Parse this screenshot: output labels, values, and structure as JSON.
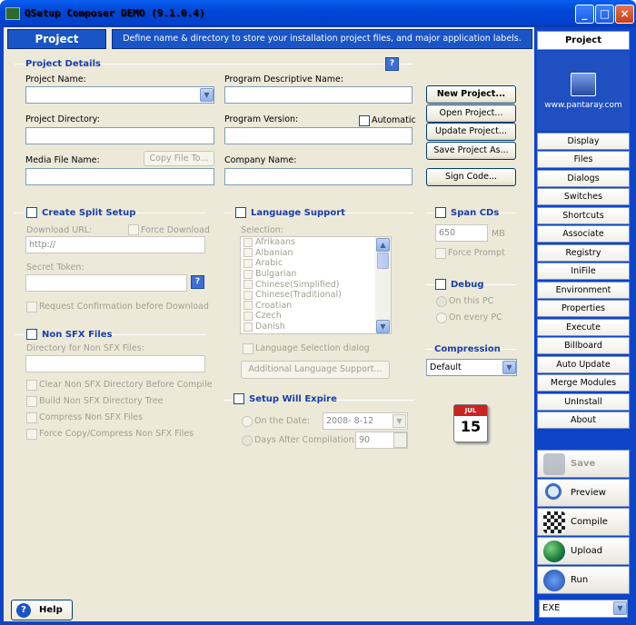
{
  "window": {
    "title": "QSetup Composer DEMO (9.1.0.4)",
    "minimize": "_",
    "maximize": "□",
    "close": "×"
  },
  "header": {
    "section": "Project",
    "description": "Define name & directory to store your installation project files, and major application labels."
  },
  "details": {
    "legend": "Project Details",
    "help": "?",
    "project_name": "Project Name:",
    "descriptive_name": "Program Descriptive Name:",
    "directory": "Project Directory:",
    "version": "Program Version:",
    "automatic": "Automatic",
    "media_file": "Media File Name:",
    "copy_file": "Copy File To...",
    "company": "Company Name:"
  },
  "project_buttons": {
    "new": "New Project...",
    "open": "Open Project...",
    "update": "Update Project...",
    "save_as": "Save Project As...",
    "sign": "Sign Code..."
  },
  "split": {
    "title": "Create Split Setup",
    "download_url": "Download URL:",
    "force_download": "Force Download",
    "url_value": "http://",
    "secret_token": "Secret Token:",
    "help": "?",
    "request_confirm": "Request Confirmation before Download"
  },
  "nonsfx": {
    "title": "Non SFX Files",
    "dir": "Directory for Non SFX Files:",
    "options": [
      "Clear Non SFX Directory Before Compile",
      "Build Non SFX Directory Tree",
      "Compress Non SFX Files",
      "Force Copy/Compress Non SFX Files"
    ]
  },
  "language": {
    "title": "Language Support",
    "selection": "Selection:",
    "items": [
      "Afrikaans",
      "Albanian",
      "Arabic",
      "Bulgarian",
      "Chinese(Simplified)",
      "Chinese(Traditional)",
      "Croatian",
      "Czech",
      "Danish"
    ],
    "dialog": "Language Selection dialog",
    "additional": "Additional Language Support..."
  },
  "expire": {
    "title": "Setup Will Expire",
    "on_date": "On the Date:",
    "date_value": "2008- 8-12",
    "after_compile": "Days After Compilation:",
    "days_value": "90"
  },
  "spancds": {
    "title": "Span CDs",
    "size": "650",
    "unit": "MB",
    "force_prompt": "Force Prompt"
  },
  "debug": {
    "title": "Debug",
    "on_pc": "On this PC",
    "every_pc": "On every PC"
  },
  "compression": {
    "title": "Compression",
    "value": "Default"
  },
  "calendar": {
    "month": "JUL",
    "day": "15"
  },
  "sidebar": {
    "project": "Project",
    "logo_url": "www.pantaray.com",
    "items": [
      "Display",
      "Files",
      "Dialogs",
      "Switches",
      "Shortcuts",
      "Associate",
      "Registry",
      "IniFile",
      "Environment",
      "Properties",
      "Execute",
      "Billboard",
      "Auto Update",
      "Merge Modules",
      "UnInstall",
      "About"
    ]
  },
  "actions": {
    "save": "Save",
    "preview": "Preview",
    "compile": "Compile",
    "upload": "Upload",
    "run": "Run"
  },
  "output": {
    "value": "EXE"
  },
  "footer": {
    "help": "Help"
  },
  "colors": {
    "title_blue": "#0047d6",
    "panel_bg": "#ece9d8",
    "section_blue": "#1a3faa",
    "header_blue": "#1a55c8"
  }
}
